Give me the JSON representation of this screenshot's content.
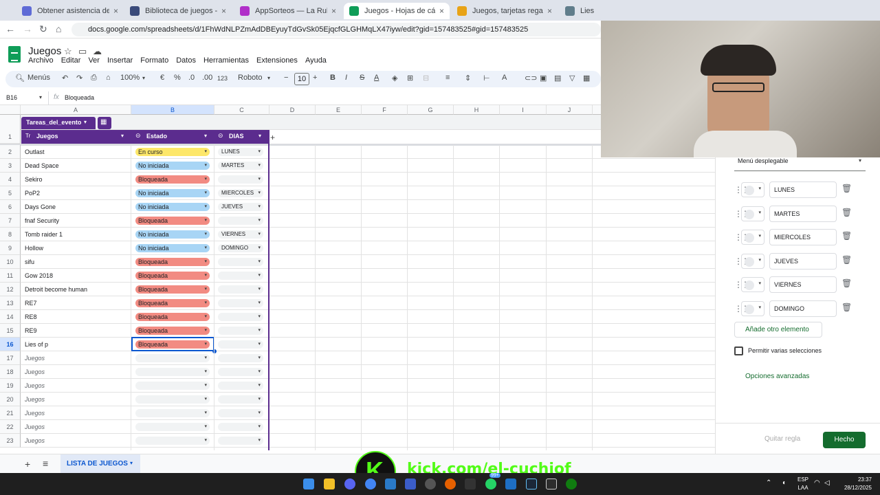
{
  "browser": {
    "tabs": [
      {
        "title": "Obtener asistencia de Vincular",
        "favicon_color": "#5f6bd6"
      },
      {
        "title": "Biblioteca de juegos - Compras",
        "favicon_color": "#3a4a7a"
      },
      {
        "title": "AppSorteos — La Ruleta de la Suerte",
        "favicon_color": "#b02fc9"
      },
      {
        "title": "Juegos - Hojas de cálculo de Google",
        "favicon_color": "#0f9d58",
        "active": true
      },
      {
        "title": "Juegos, tarjetas regalo, recargas",
        "favicon_color": "#e8a317"
      },
      {
        "title": "Lies of P",
        "favicon_color": "#607d8b"
      }
    ],
    "close_icon": "×",
    "url": "docs.google.com/spreadsheets/d/1FhWdNLPZmAdDBEyuyTdGvSk05EjqcfGLGHMqLX47iyw/edit?gid=157483525#gid=157483525"
  },
  "sheets": {
    "title": "Juegos",
    "menu": [
      "Archivo",
      "Editar",
      "Ver",
      "Insertar",
      "Formato",
      "Datos",
      "Herramientas",
      "Extensiones",
      "Ayuda"
    ],
    "toolbar": {
      "search": "Menús",
      "zoom": "100%",
      "currency": "€",
      "percent": "%",
      "dec_less": ".0",
      "dec_more": ".00",
      "format_123": "123",
      "font": "Roboto",
      "font_size": "10",
      "bold": "B",
      "italic": "I",
      "strike": "S",
      "text_color": "A"
    },
    "name_box": "B16",
    "formula_label": "fx",
    "formula": "Bloqueada",
    "columns": [
      "A",
      "B",
      "C",
      "D",
      "E",
      "F",
      "G",
      "H",
      "I",
      "J"
    ],
    "table_name": "Tareas_del_evento",
    "col_headers": {
      "a_prefix": "Tr",
      "a": "Juegos",
      "b": "Estado",
      "c": "DIAS"
    },
    "rows": [
      {
        "n": "2",
        "juego": "Outlast",
        "estado": "En curso",
        "dia": "LUNES"
      },
      {
        "n": "3",
        "juego": "Dead Space",
        "estado": "No iniciada",
        "dia": "MARTES"
      },
      {
        "n": "4",
        "juego": "Sekiro",
        "estado": "Bloqueada",
        "dia": ""
      },
      {
        "n": "5",
        "juego": "PoP2",
        "estado": "No iniciada",
        "dia": "MIERCOLES"
      },
      {
        "n": "6",
        "juego": "Days Gone",
        "estado": "No iniciada",
        "dia": "JUEVES"
      },
      {
        "n": "7",
        "juego": "fnaf Security",
        "estado": "Bloqueada",
        "dia": ""
      },
      {
        "n": "8",
        "juego": "Tomb raider 1",
        "estado": "No iniciada",
        "dia": "VIERNES"
      },
      {
        "n": "9",
        "juego": "Hollow",
        "estado": "No iniciada",
        "dia": "DOMINGO"
      },
      {
        "n": "10",
        "juego": "sifu",
        "estado": "Bloqueada",
        "dia": ""
      },
      {
        "n": "11",
        "juego": "Gow 2018",
        "estado": "Bloqueada",
        "dia": ""
      },
      {
        "n": "12",
        "juego": "Detroit become human",
        "estado": "Bloqueada",
        "dia": ""
      },
      {
        "n": "13",
        "juego": "RE7",
        "estado": "Bloqueada",
        "dia": ""
      },
      {
        "n": "14",
        "juego": "RE8",
        "estado": "Bloqueada",
        "dia": ""
      },
      {
        "n": "15",
        "juego": "RE9",
        "estado": "Bloqueada",
        "dia": ""
      },
      {
        "n": "16",
        "juego": "Lies of p",
        "estado": "Bloqueada",
        "dia": ""
      },
      {
        "n": "17",
        "juego": "Juegos",
        "estado": "",
        "dia": "",
        "placeholder": true
      },
      {
        "n": "18",
        "juego": "Juegos",
        "estado": "",
        "dia": "",
        "placeholder": true
      },
      {
        "n": "19",
        "juego": "Juegos",
        "estado": "",
        "dia": "",
        "placeholder": true
      },
      {
        "n": "20",
        "juego": "Juegos",
        "estado": "",
        "dia": "",
        "placeholder": true
      },
      {
        "n": "21",
        "juego": "Juegos",
        "estado": "",
        "dia": "",
        "placeholder": true
      },
      {
        "n": "22",
        "juego": "Juegos",
        "estado": "",
        "dia": "",
        "placeholder": true
      },
      {
        "n": "23",
        "juego": "Juegos",
        "estado": "",
        "dia": "",
        "placeholder": true
      }
    ],
    "status_colors": {
      "En curso": "#fde769",
      "No iniciada": "#a8d5f5",
      "Bloqueada": "#f28b82",
      "": "#f1f3f4"
    },
    "sheet_tab": "LISTA DE JUEGOS",
    "add_sheet": "+",
    "sheet_list_icon": "≡"
  },
  "sidepanel": {
    "dropdown_type": "Menú desplegable",
    "items": [
      "LUNES",
      "MARTES",
      "MIERCOLES",
      "JUEVES",
      "VIERNES",
      "DOMINGO"
    ],
    "add_item": "Añade otro elemento",
    "multi_select": "Permitir varias selecciones",
    "advanced": "Opciones avanzadas",
    "remove_rule": "Quitar regla",
    "done": "Hecho"
  },
  "overlay": {
    "kick_text": "kick.com/el-cuchiof"
  },
  "taskbar": {
    "lang_top": "ESP",
    "lang_bottom": "LAA",
    "time": "23:37",
    "date": "28/12/2025",
    "badge": "99+"
  },
  "accent": "#0b57d0",
  "table_header_color": "#5b2c8e"
}
